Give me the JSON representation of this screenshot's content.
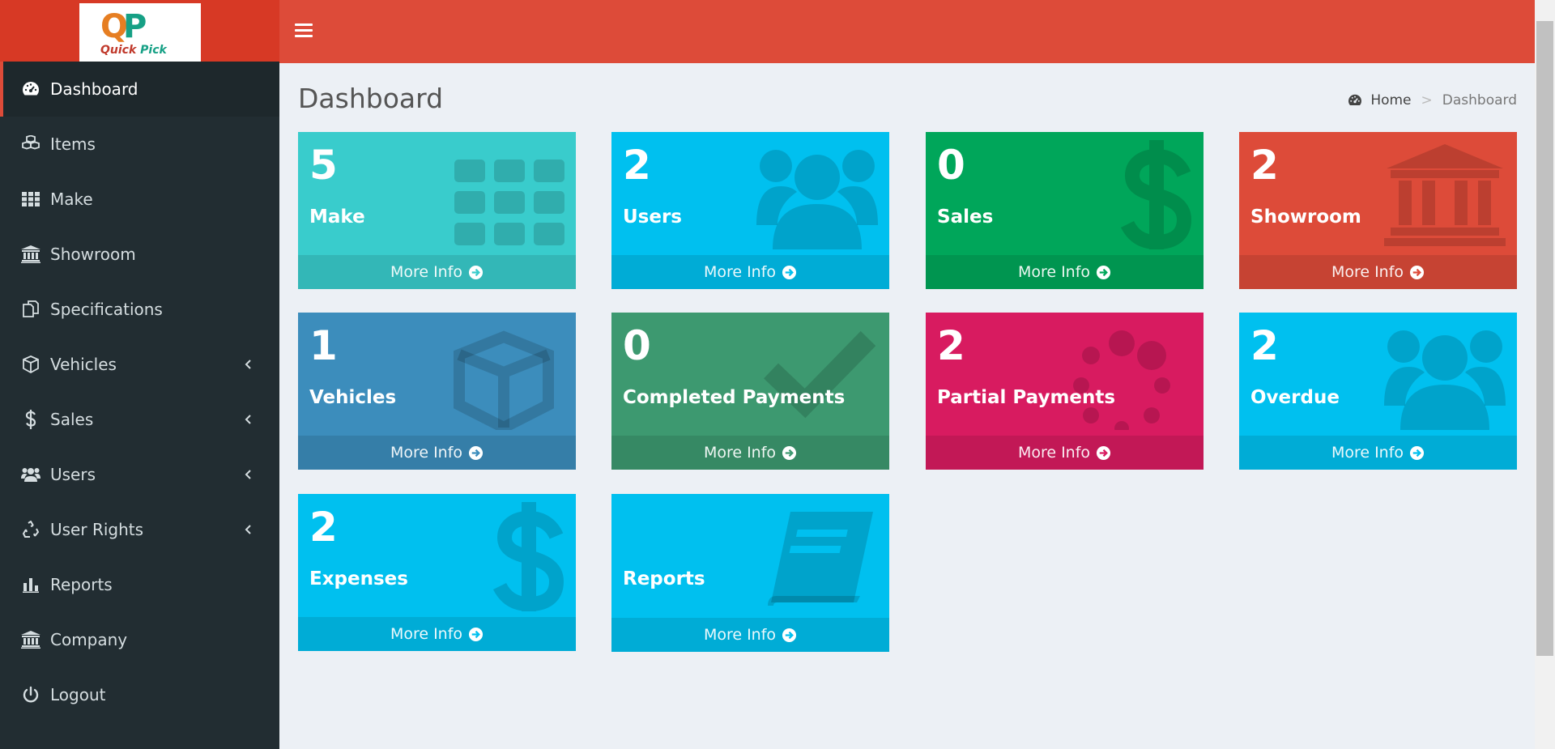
{
  "header": {
    "logo": {
      "letters_q": "Q",
      "letters_p": "P",
      "tagline_quick": "Quick",
      "tagline_pick": "Pick"
    },
    "menu_icon": "hamburger-icon"
  },
  "sidebar": {
    "items": [
      {
        "label": "Dashboard",
        "icon": "dashboard-icon",
        "active": true
      },
      {
        "label": "Items",
        "icon": "cubes-icon"
      },
      {
        "label": "Make",
        "icon": "grid-icon"
      },
      {
        "label": "Showroom",
        "icon": "bank-icon"
      },
      {
        "label": "Specifications",
        "icon": "copy-icon"
      },
      {
        "label": "Vehicles",
        "icon": "cube-icon",
        "has_submenu": true
      },
      {
        "label": "Sales",
        "icon": "dollar-icon",
        "has_submenu": true
      },
      {
        "label": "Users",
        "icon": "users-icon",
        "has_submenu": true
      },
      {
        "label": "User Rights",
        "icon": "recycle-icon",
        "has_submenu": true
      },
      {
        "label": "Reports",
        "icon": "bar-chart-icon"
      },
      {
        "label": "Company",
        "icon": "bank-icon"
      },
      {
        "label": "Logout",
        "icon": "power-icon"
      }
    ]
  },
  "page": {
    "title": "Dashboard",
    "breadcrumb": {
      "home": "Home",
      "current": "Dashboard"
    }
  },
  "boxes": [
    {
      "number": "5",
      "label": "Make",
      "footer": "More Info",
      "color": "#39cccc",
      "icon": "grid-icon"
    },
    {
      "number": "2",
      "label": "Users",
      "footer": "More Info",
      "color": "#00c0ef",
      "icon": "users-icon"
    },
    {
      "number": "0",
      "label": "Sales",
      "footer": "More Info",
      "color": "#00a65a",
      "icon": "dollar-icon"
    },
    {
      "number": "2",
      "label": "Showroom",
      "footer": "More Info",
      "color": "#dd4b39",
      "icon": "bank-icon"
    },
    {
      "number": "1",
      "label": "Vehicles",
      "footer": "More Info",
      "color": "#3c8dbc",
      "icon": "cube-icon"
    },
    {
      "number": "0",
      "label": "Completed Payments",
      "footer": "More Info",
      "color": "#3d9970",
      "icon": "check-icon"
    },
    {
      "number": "2",
      "label": "Partial Payments",
      "footer": "More Info",
      "color": "#d81b60",
      "icon": "spinner-icon"
    },
    {
      "number": "2",
      "label": "Overdue",
      "footer": "More Info",
      "color": "#00c0ef",
      "icon": "users-icon"
    },
    {
      "number": "2",
      "label": "Expenses",
      "footer": "More Info",
      "color": "#00c0ef",
      "icon": "dollar-icon"
    },
    {
      "number": "",
      "label": "Reports",
      "footer": "More Info",
      "color": "#00c0ef",
      "icon": "book-icon"
    }
  ]
}
